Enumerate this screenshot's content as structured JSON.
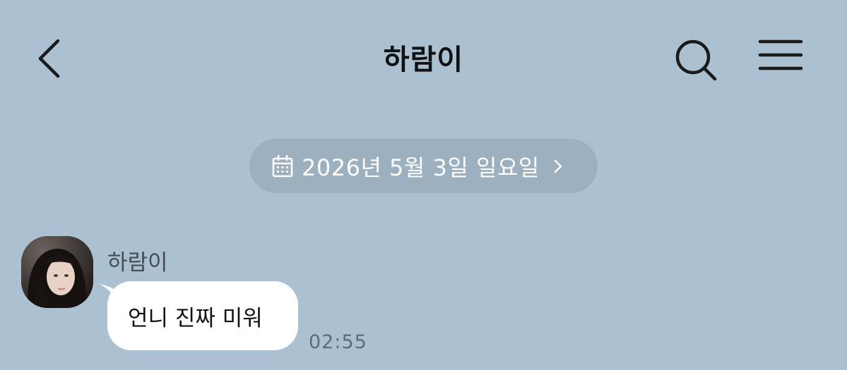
{
  "header": {
    "title": "하람이",
    "back_icon": "chevron-left-icon",
    "search_icon": "search-icon",
    "menu_icon": "hamburger-menu-icon"
  },
  "date_divider": {
    "icon": "calendar-icon",
    "text": "2026년 5월 3일 일요일",
    "chevron": "chevron-right-icon"
  },
  "messages": [
    {
      "sender": "하람이",
      "text": "언니 진짜 미워",
      "time": "02:55"
    }
  ],
  "colors": {
    "background": "#abc1d1",
    "date_chip": "#9cb0c0",
    "bubble": "#ffffff"
  }
}
